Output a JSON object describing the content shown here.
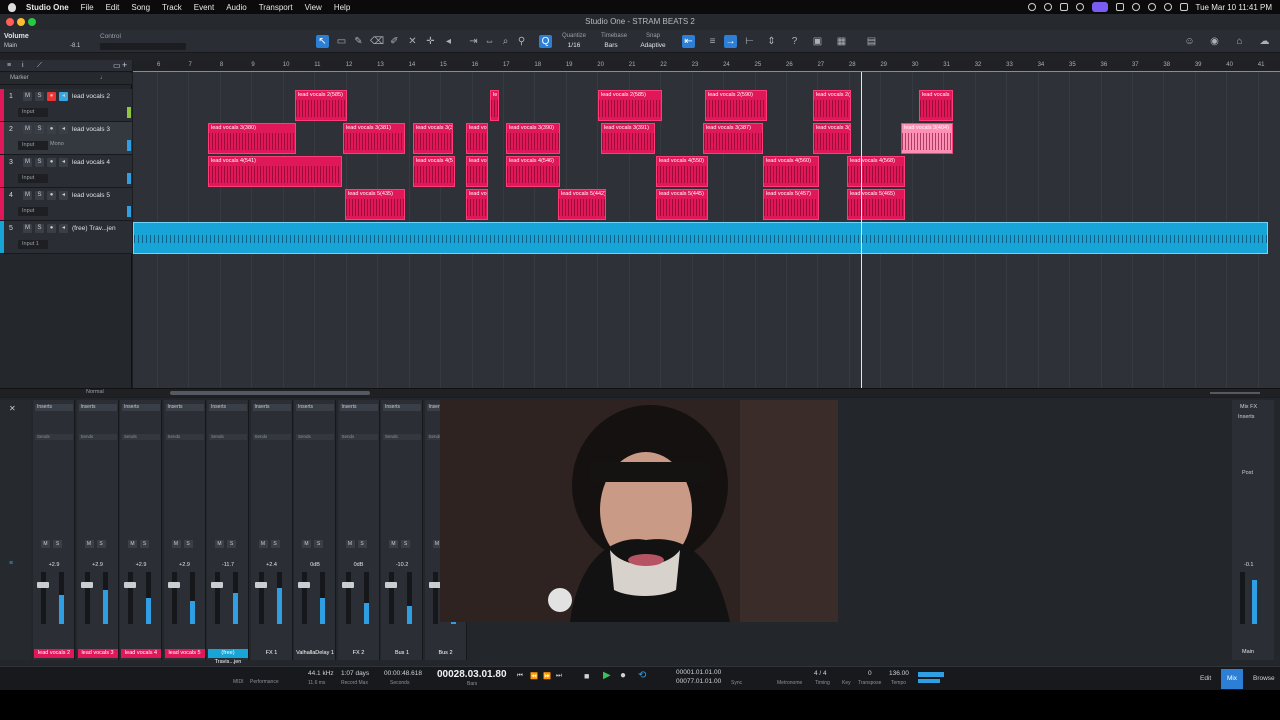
{
  "menubar": {
    "app": "Studio One",
    "items": [
      "File",
      "Edit",
      "Song",
      "Track",
      "Event",
      "Audio",
      "Transport",
      "View",
      "Help"
    ],
    "clock": "Tue Mar 10  11:41 PM"
  },
  "window": {
    "title": "Studio One - STRAM BEATS 2"
  },
  "inspector": {
    "param": "Volume",
    "control": "Control",
    "target": "Main",
    "value": "-8.1"
  },
  "toolbar": {
    "quantize_label": "Quantize",
    "quantize_value": "1/16",
    "timebase_label": "Timebase",
    "timebase_value": "Bars",
    "snap_label": "Snap",
    "snap_value": "Adaptive"
  },
  "marker_label": "Marker",
  "ruler": [
    "6",
    "7",
    "8",
    "9",
    "10",
    "11",
    "12",
    "13",
    "14",
    "15",
    "16",
    "17",
    "18",
    "19",
    "20",
    "21",
    "22",
    "23",
    "24",
    "25",
    "26",
    "27",
    "28",
    "29",
    "30",
    "31",
    "32",
    "33",
    "34",
    "35",
    "36",
    "37",
    "38",
    "39",
    "40",
    "41"
  ],
  "tracks": [
    {
      "num": "1",
      "name": "lead vocals 2",
      "input": "Input",
      "color": "#e0185a"
    },
    {
      "num": "2",
      "name": "lead vocals 3",
      "input": "Input",
      "mode": "Mono",
      "color": "#e0185a"
    },
    {
      "num": "3",
      "name": "lead vocals 4",
      "input": "Input",
      "color": "#e0185a"
    },
    {
      "num": "4",
      "name": "lead vocals 5",
      "input": "Input",
      "color": "#e0185a"
    },
    {
      "num": "5",
      "name": "(free) Trav...jen",
      "input": "Input 1",
      "color": "#17a5d8"
    }
  ],
  "clips": [
    {
      "label": "lead vocals 2(585)",
      "lane": 0
    },
    {
      "label": "le",
      "lane": 0
    },
    {
      "label": "lead vocals 2(585)",
      "lane": 0
    },
    {
      "label": "lead vocals 2(590)",
      "lane": 0
    },
    {
      "label": "lead vocals 2(",
      "lane": 0
    },
    {
      "label": "lead vocals",
      "lane": 0
    },
    {
      "label": "lead vocals 3(380)",
      "lane": 1
    },
    {
      "label": "lead vocals 3(381)",
      "lane": 1
    },
    {
      "label": "lead vocals 3(3",
      "lane": 1
    },
    {
      "label": "lead vo",
      "lane": 1
    },
    {
      "label": "lead vocals 3(390)",
      "lane": 1
    },
    {
      "label": "lead vocals 3(391)",
      "lane": 1
    },
    {
      "label": "lead vocals 3(387)",
      "lane": 1
    },
    {
      "label": "lead vocals 3(",
      "lane": 1
    },
    {
      "label": "lead vocals 3(404)",
      "lane": 1
    },
    {
      "label": "lead vocals 4(541)",
      "lane": 2
    },
    {
      "label": "lead vocals 4(5",
      "lane": 2
    },
    {
      "label": "lead vo",
      "lane": 2
    },
    {
      "label": "lead vocals 4(546)",
      "lane": 2
    },
    {
      "label": "lead vocals 4(550)",
      "lane": 2
    },
    {
      "label": "lead vocals 4(560)",
      "lane": 2
    },
    {
      "label": "lead vocals 4(568)",
      "lane": 2
    },
    {
      "label": "lead vocals 5(435)",
      "lane": 3
    },
    {
      "label": "lead vo",
      "lane": 3
    },
    {
      "label": "lead vocals 5(442)",
      "lane": 3
    },
    {
      "label": "lead vocals 5(445)",
      "lane": 3
    },
    {
      "label": "lead vocals 5(457)",
      "lane": 3
    },
    {
      "label": "lead vocals 5(465)",
      "lane": 3
    }
  ],
  "arrange_footer": {
    "mode": "Normal"
  },
  "mixer": {
    "strips": [
      {
        "name": "lead vocals 2",
        "vol": "+2.9",
        "num": "1",
        "color": "#e0185a",
        "level": 0.55
      },
      {
        "name": "lead vocals 3",
        "vol": "+2.9",
        "num": "2",
        "color": "#e0185a",
        "level": 0.65
      },
      {
        "name": "lead vocals 4",
        "vol": "+2.9",
        "num": "3",
        "color": "#e0185a",
        "level": 0.5
      },
      {
        "name": "lead vocals 5",
        "vol": "+2.9",
        "num": "4",
        "color": "#e0185a",
        "level": 0.45
      },
      {
        "name": "(free) Travis...jen",
        "vol": "-11.7",
        "num": "5",
        "color": "#17a5d8",
        "level": 0.6
      },
      {
        "name": "FX 1",
        "vol": "+2.4",
        "num": "6",
        "color": "#2b2e34",
        "level": 0.7
      },
      {
        "name": "ValhallaDelay 1",
        "vol": "0dB",
        "num": "7",
        "color": "#2b2e34",
        "level": 0.5
      },
      {
        "name": "FX 2",
        "vol": "0dB",
        "num": "8",
        "color": "#2b2e34",
        "level": 0.4
      },
      {
        "name": "Bus 1",
        "vol": "-10.2",
        "num": "9",
        "color": "#2b2e34",
        "level": 0.35
      },
      {
        "name": "Bus 2",
        "vol": "",
        "num": "10",
        "color": "#2b2e34",
        "level": 0.2
      }
    ],
    "inserts_label": "Inserts",
    "sends_label": "Sends",
    "mixfx_label": "Mix FX",
    "main": {
      "name": "Main",
      "vol": "-0.1",
      "mixfx": "Mix FX",
      "inserts": "Inserts",
      "post": "Post"
    }
  },
  "transport": {
    "midi": "MIDI",
    "performance": "Performance",
    "samplerate": "44.1 kHz",
    "latency": "11.6 ms",
    "record_days": "1:07 days",
    "record_max": "Record Max",
    "seconds_time": "00:00:48.618",
    "seconds_label": "Seconds",
    "position": "00028.03.01.80",
    "bars_label": "Bars",
    "loop_start": "00001.01.01.00",
    "loop_end": "00077.01.01.00",
    "sync": "Sync",
    "metronome": "Metronome",
    "timing": "Timing",
    "signature": "4 / 4",
    "key": "Key",
    "transpose": "0",
    "transpose_label": "Transpose",
    "tempo": "136.00",
    "tempo_label": "Tempo",
    "edit": "Edit",
    "mix": "Mix",
    "browse": "Browse"
  }
}
